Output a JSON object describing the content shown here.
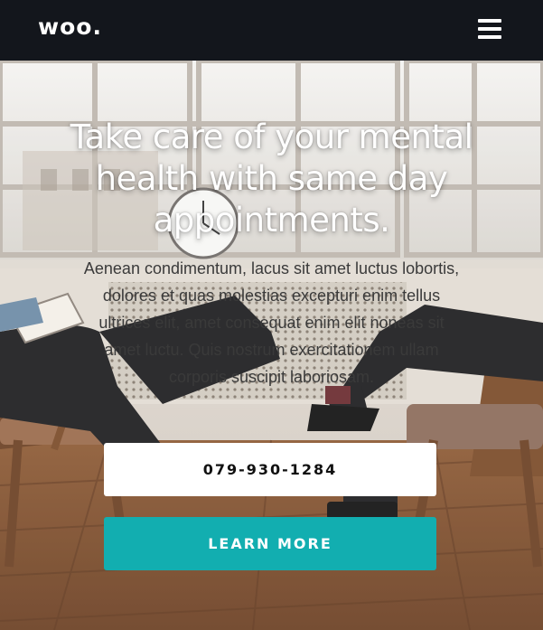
{
  "header": {
    "logo": "woo.",
    "menu_icon": "hamburger-menu-icon"
  },
  "hero": {
    "headline": "Take care of your mental health with same day appointments.",
    "body": "Aenean condimentum, lacus sit amet luctus lobortis, dolores et quas molestias excepturi enim tellus ultrices elit, amet consequat enim elit noneas sit amet luctu. Quis nostrum exercitationem ullam corporis suscipit laboriosam.",
    "phone_button": "079-930-1284",
    "learn_more_button": "LEARN MORE"
  },
  "colors": {
    "topbar": "#13161c",
    "accent": "#12aeb0",
    "white": "#ffffff"
  }
}
